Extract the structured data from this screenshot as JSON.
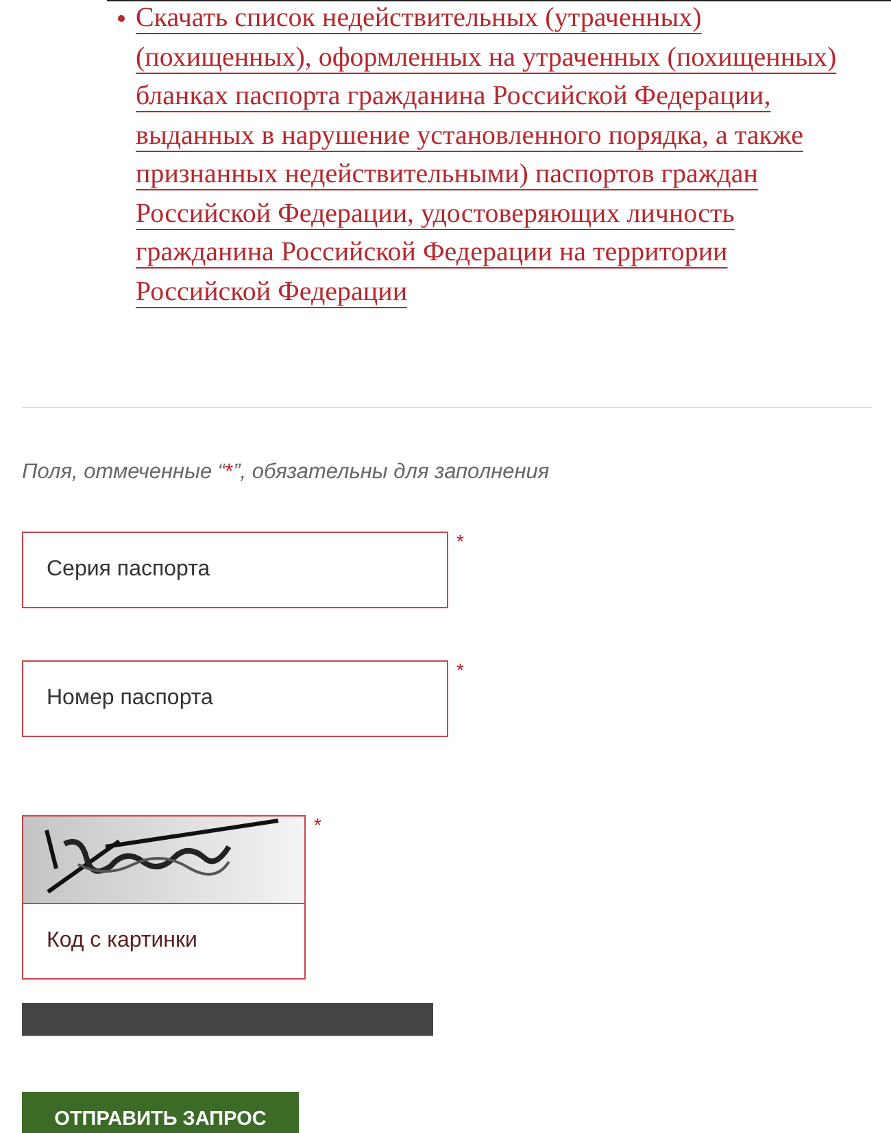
{
  "download_links": [
    {
      "text": "Скачать список недействительных (утраченных) (похищенных), оформленных на утраченных (похищенных) бланках паспорта гражданина Российской Федерации, выданных в нарушение установленного порядка, а также признанных недействительными) паспортов граждан Российской Федерации, удостоверяющих личность гражданина Российской Федерации на территории Российской Федерации"
    }
  ],
  "required_note": {
    "text_before": "Поля, отмеченные “",
    "mark": "*",
    "text_after": "”, обязательны для заполнения"
  },
  "fields": [
    {
      "kind": "text",
      "placeholder": "Серия паспорта",
      "required_mark": "*"
    },
    {
      "kind": "text",
      "placeholder": "Номер паспорта",
      "required_mark": "*"
    },
    {
      "kind": "captcha",
      "placeholder": "Код с картинки",
      "required_mark": "*"
    }
  ],
  "submit_button": {
    "label": "ОТПРАВИТЬ ЗАПРОС"
  }
}
